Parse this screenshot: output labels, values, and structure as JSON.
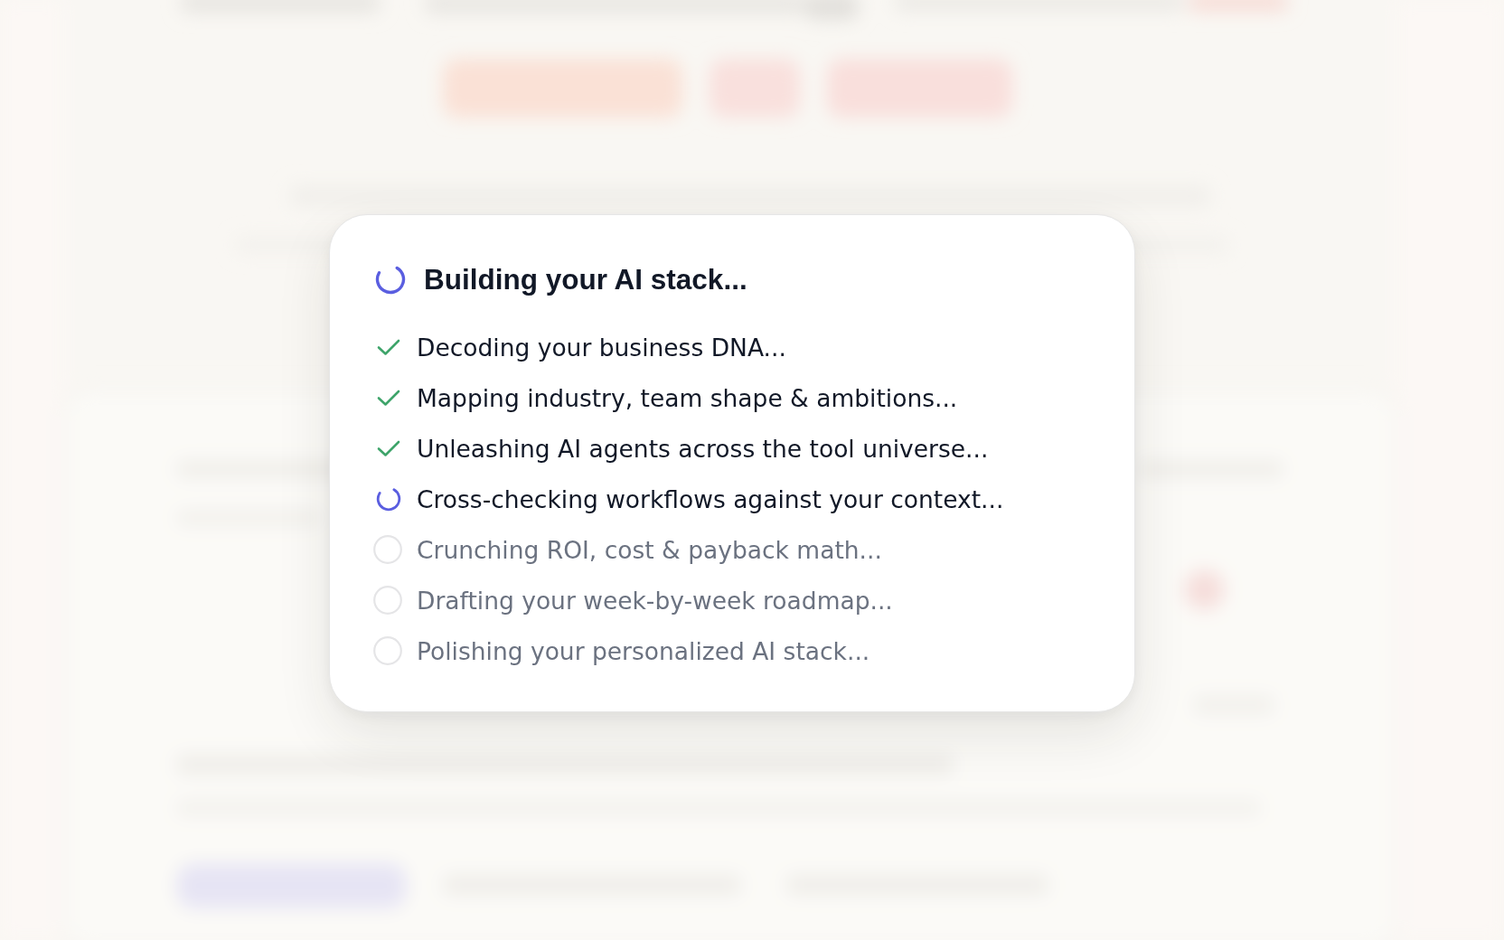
{
  "dialog": {
    "title": "Building your AI stack...",
    "steps": [
      {
        "label": "Decoding your business DNA...",
        "kind": "done"
      },
      {
        "label": "Mapping industry, team shape & ambitions...",
        "kind": "done"
      },
      {
        "label": "Unleashing AI agents across the tool universe...",
        "kind": "done"
      },
      {
        "label": "Cross-checking workflows against your context...",
        "kind": "active"
      },
      {
        "label": "Crunching ROI, cost & payback math...",
        "kind": "pending"
      },
      {
        "label": "Drafting your week-by-week roadmap...",
        "kind": "pending"
      },
      {
        "label": "Polishing your personalized AI stack...",
        "kind": "pending"
      }
    ]
  }
}
